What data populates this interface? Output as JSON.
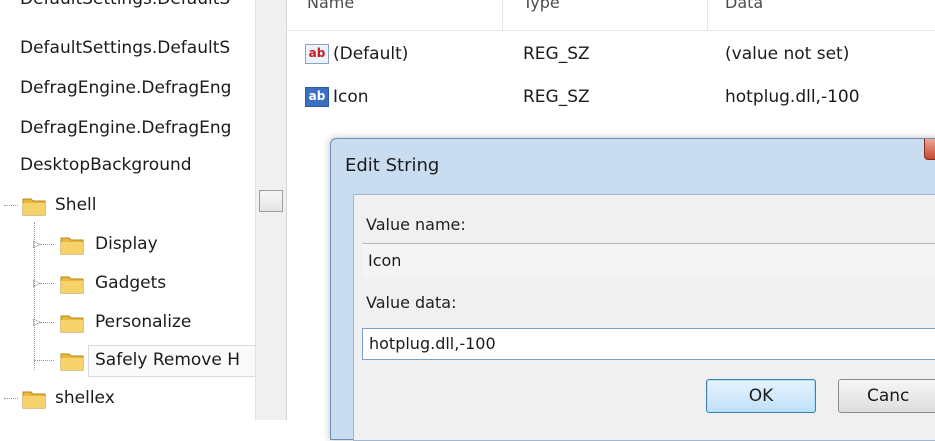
{
  "tree": {
    "items": [
      {
        "label": "DefaultSettings.DefaultS"
      },
      {
        "label": "DefaultSettings.DefaultS"
      },
      {
        "label": "DefragEngine.DefragEng"
      },
      {
        "label": "DefragEngine.DefragEng"
      },
      {
        "label": "DesktopBackground"
      },
      {
        "label": "Shell"
      },
      {
        "label": "Display"
      },
      {
        "label": "Gadgets"
      },
      {
        "label": "Personalize"
      },
      {
        "label": "Safely Remove H"
      },
      {
        "label": "shellex"
      }
    ]
  },
  "values": {
    "columns": [
      "Name",
      "Type",
      "Data"
    ],
    "rows": [
      {
        "name": "(Default)",
        "type": "REG_SZ",
        "data": "(value not set)",
        "icon": "string-value-icon"
      },
      {
        "name": "Icon",
        "type": "REG_SZ",
        "data": "hotplug.dll,-100",
        "icon": "string-value-icon"
      }
    ]
  },
  "dialog": {
    "title": "Edit String",
    "value_name_label": "Value name:",
    "value_name": "Icon",
    "value_data_label": "Value data:",
    "value_data": "hotplug.dll,-100",
    "ok_label": "OK",
    "cancel_label": "Canc"
  },
  "colors": {
    "folder": "#e8b83a",
    "dialog_frame": "#c9dcf0",
    "ok_border": "#3c7fb1"
  }
}
